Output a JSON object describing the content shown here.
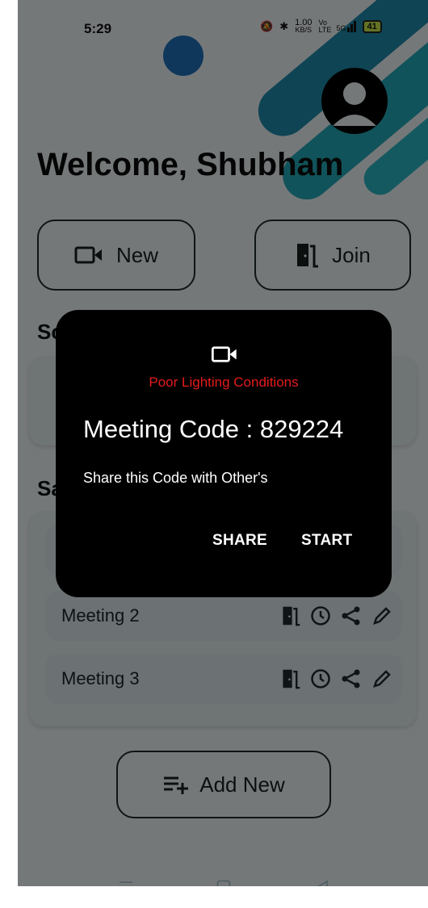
{
  "status_bar": {
    "time": "5:29",
    "net_speed": "1.00",
    "net_unit": "KB/S",
    "volte": "Vo LTE",
    "network": "5G",
    "battery": "41"
  },
  "header": {
    "welcome": "Welcome, Shubham"
  },
  "actions": {
    "new_label": "New",
    "join_label": "Join"
  },
  "sections": {
    "scheduled_partial": "Sc",
    "saved_partial": "Sa"
  },
  "meetings": [
    {
      "name": "Meeting 2"
    },
    {
      "name": "Meeting 3"
    }
  ],
  "add_new_label": "Add New",
  "dialog": {
    "warning": "Poor Lighting Conditions",
    "code_text": "Meeting Code : 829224",
    "share_hint": "Share this Code with Other's",
    "share_button": "SHARE",
    "start_button": "START"
  },
  "colors": {
    "accent_blue": "#1f6fb8",
    "accent_teal": "#1a8c9a",
    "warning_red": "#e41b1b",
    "dialog_bg": "#000000"
  },
  "icons": {
    "profile": "avatar-icon",
    "new": "video-camera-icon",
    "join": "door-icon",
    "row": [
      "door-icon",
      "clock-icon",
      "share-icon",
      "pencil-icon"
    ],
    "add_new": "playlist-add-icon"
  }
}
